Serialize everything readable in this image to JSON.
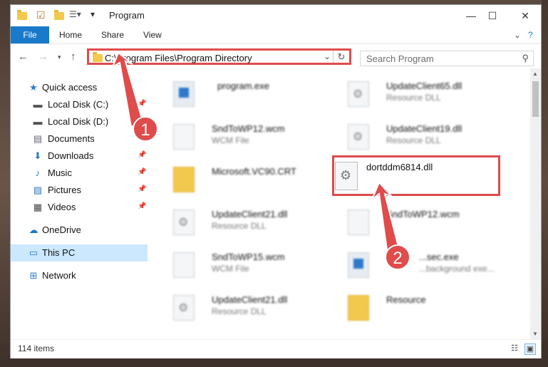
{
  "window": {
    "title": "Program"
  },
  "ribbon": {
    "tabs": [
      "File",
      "Home",
      "Share",
      "View"
    ]
  },
  "address": {
    "path": "C:\\Program Files\\Program Directory"
  },
  "search": {
    "placeholder": "Search Program"
  },
  "nav": {
    "items": [
      {
        "label": "Quick access",
        "icon": "star-icon"
      },
      {
        "label": "Local Disk (C:)",
        "icon": "drive-icon"
      },
      {
        "label": "Local Disk (D:)",
        "icon": "drive-icon"
      },
      {
        "label": "Documents",
        "icon": "documents-icon"
      },
      {
        "label": "Downloads",
        "icon": "download-icon"
      },
      {
        "label": "Music",
        "icon": "music-icon"
      },
      {
        "label": "Pictures",
        "icon": "pictures-icon"
      },
      {
        "label": "Videos",
        "icon": "videos-icon"
      },
      {
        "label": "OneDrive",
        "icon": "cloud-icon"
      },
      {
        "label": "This PC",
        "icon": "computer-icon"
      },
      {
        "label": "Network",
        "icon": "network-icon"
      }
    ]
  },
  "files": [
    {
      "name": "program.exe",
      "type": ""
    },
    {
      "name": "UpdateClient65.dll",
      "type": "Resource DLL"
    },
    {
      "name": "SndToWP12.wcm",
      "type": "WCM File"
    },
    {
      "name": "UpdateClient19.dll",
      "type": "Resource DLL"
    },
    {
      "name": "Microsoft.VC90.CRT",
      "type": ""
    },
    {
      "name": "dortddm6814.dll",
      "type": ""
    },
    {
      "name": "UpdateClient21.dll",
      "type": "Resource DLL"
    },
    {
      "name": "SndToWP12.wcm",
      "type": ""
    },
    {
      "name": "SndToWP15.wcm",
      "type": "WCM File"
    },
    {
      "name": "...sec.exe",
      "type": "...background exe..."
    },
    {
      "name": "UpdateClient21.dll",
      "type": "Resource DLL"
    },
    {
      "name": "Resource",
      "type": ""
    }
  ],
  "status": {
    "item_count": "114 items"
  },
  "annotations": {
    "badge1": "1",
    "badge2": "2"
  },
  "colors": {
    "accent": "#1979ca",
    "highlight": "#e04b4b",
    "selected": "#cce8ff"
  }
}
